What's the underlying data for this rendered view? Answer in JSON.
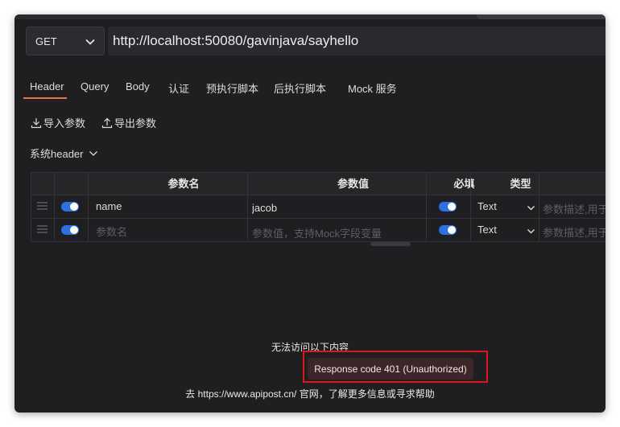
{
  "request": {
    "method": "GET",
    "url": "http://localhost:50080/gavinjava/sayhello"
  },
  "tabs": [
    {
      "label": "Header",
      "active": true
    },
    {
      "label": "Query"
    },
    {
      "label": "Body"
    },
    {
      "label": "认证"
    },
    {
      "label": "预执行脚本"
    },
    {
      "label": "后执行脚本"
    },
    {
      "label": "Mock 服务"
    }
  ],
  "actions": {
    "import_label": "导入参数",
    "export_label": "导出参数"
  },
  "system_header_label": "系统header",
  "table": {
    "headers": [
      "参数名",
      "参数值",
      "必填",
      "类型"
    ],
    "rows": [
      {
        "name": "name",
        "value": "jacob",
        "required": true,
        "type": "Text",
        "description_placeholder": "参数描述,用于"
      },
      {
        "name_placeholder": "参数名",
        "value_placeholder": "参数值，支持Mock字段变量",
        "required": true,
        "type": "Text",
        "description_placeholder": "参数描述,用于"
      }
    ]
  },
  "error": {
    "title": "无法访问以下内容",
    "message": "Response code 401 (Unauthorized)",
    "help": "去 https://www.apipost.cn/ 官网，了解更多信息或寻求帮助"
  },
  "colors": {
    "accent": "#e8743b",
    "toggle_on": "#2f6fe6",
    "highlight_box": "#e8121c"
  },
  "icons": [
    "chevron-down-icon",
    "import-icon",
    "export-icon",
    "drag-handle-icon"
  ]
}
